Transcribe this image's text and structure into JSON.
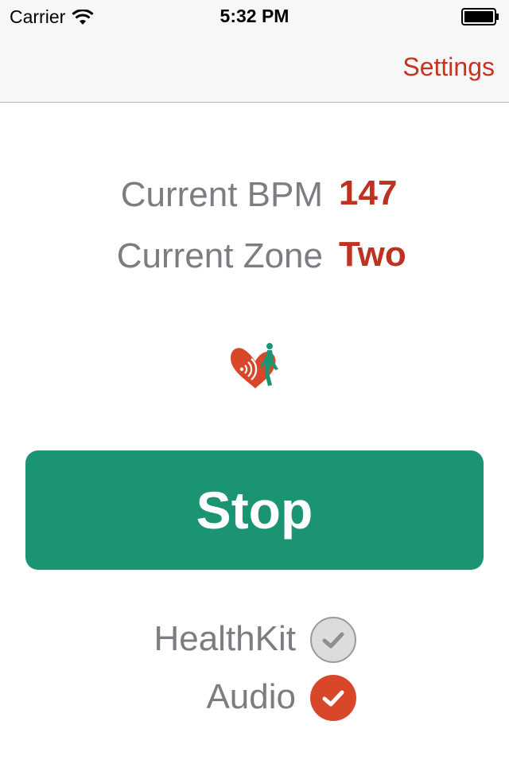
{
  "status_bar": {
    "carrier": "Carrier",
    "time": "5:32 PM",
    "icons": [
      "wifi-icon",
      "battery-icon"
    ]
  },
  "nav": {
    "settings_label": "Settings"
  },
  "readings": {
    "bpm_label": "Current BPM",
    "bpm_value": "147",
    "zone_label": "Current Zone",
    "zone_value": "Two"
  },
  "logo": {
    "icon": "heart-runner-logo"
  },
  "stop_button": {
    "label": "Stop"
  },
  "toggles": [
    {
      "label": "HealthKit",
      "checked": false
    },
    {
      "label": "Audio",
      "checked": true
    }
  ],
  "colors": {
    "accent_red": "#bf3121",
    "primary_green": "#1b9474",
    "muted_gray": "#7c7c82",
    "unchecked_fill": "#dcdcdc",
    "checked_fill": "#d9472a"
  }
}
